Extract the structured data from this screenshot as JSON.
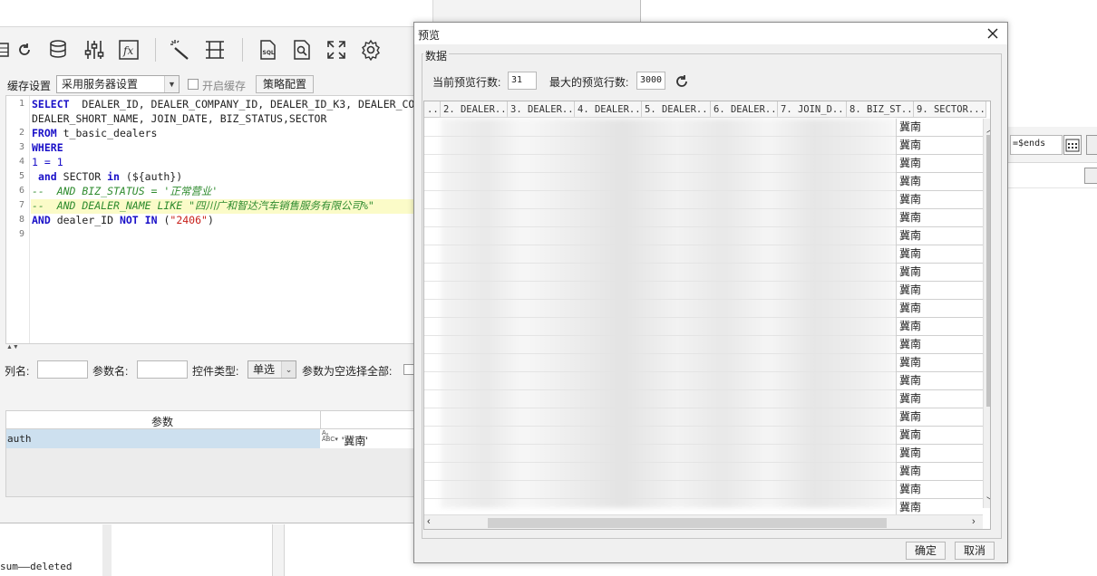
{
  "editor_window": {
    "cache_label": "缓存设置",
    "cache_select_value": "采用服务器设置",
    "enable_cache_label": "开启缓存",
    "strategy_button": "策略配置",
    "code_lines": [
      {
        "num": "1",
        "text": "SELECT  DEALER_ID, DEALER_COMPANY_ID, DEALER_ID_K3, DEALER_CO"
      },
      {
        "num": "",
        "text": "DEALER_SHORT_NAME, JOIN_DATE, BIZ_STATUS,SECTOR"
      },
      {
        "num": "2",
        "text": "FROM t_basic_dealers"
      },
      {
        "num": "3",
        "text": "WHERE"
      },
      {
        "num": "4",
        "text": "1 = 1"
      },
      {
        "num": "5",
        "text": " and SECTOR in (${auth})"
      },
      {
        "num": "6",
        "text": "--  AND BIZ_STATUS = '正常营业'"
      },
      {
        "num": "7",
        "text": "--  AND DEALER_NAME LIKE \"四川广和智达汽车销售服务有限公司%\""
      },
      {
        "num": "8",
        "text": "AND dealer_ID NOT IN (\"2406\")"
      },
      {
        "num": "9",
        "text": ""
      }
    ],
    "column_name_label": "列名:",
    "param_name_label": "参数名:",
    "control_type_label": "控件类型:",
    "control_type_value": "单选",
    "select_all_label": "参数为空选择全部:",
    "params_header": "参数",
    "param_row_name": "auth",
    "param_row_value": "'冀南'",
    "bottom_text": "sum——deleted"
  },
  "right_panel": {
    "field_value": "=$ends"
  },
  "preview_dialog": {
    "title": "预览",
    "group_label": "数据",
    "current_rows_label": "当前预览行数:",
    "current_rows_value": "31",
    "max_rows_label": "最大的预览行数:",
    "max_rows_value": "3000",
    "columns": [
      "..",
      "2. DEALER...",
      "3. DEALER...",
      "4. DEALER...",
      "5. DEALER...",
      "6. DEALER...",
      "7. JOIN_D...",
      "8. BIZ_ST...",
      "9. SECTOR..."
    ],
    "sector_values": [
      "冀南",
      "冀南",
      "冀南",
      "冀南",
      "冀南",
      "冀南",
      "冀南",
      "冀南",
      "冀南",
      "冀南",
      "冀南",
      "冀南",
      "冀南",
      "冀南",
      "冀南",
      "冀南",
      "冀南",
      "冀南",
      "冀南",
      "冀南",
      "冀南",
      "冀南"
    ],
    "ok_button": "确定",
    "cancel_button": "取消"
  }
}
